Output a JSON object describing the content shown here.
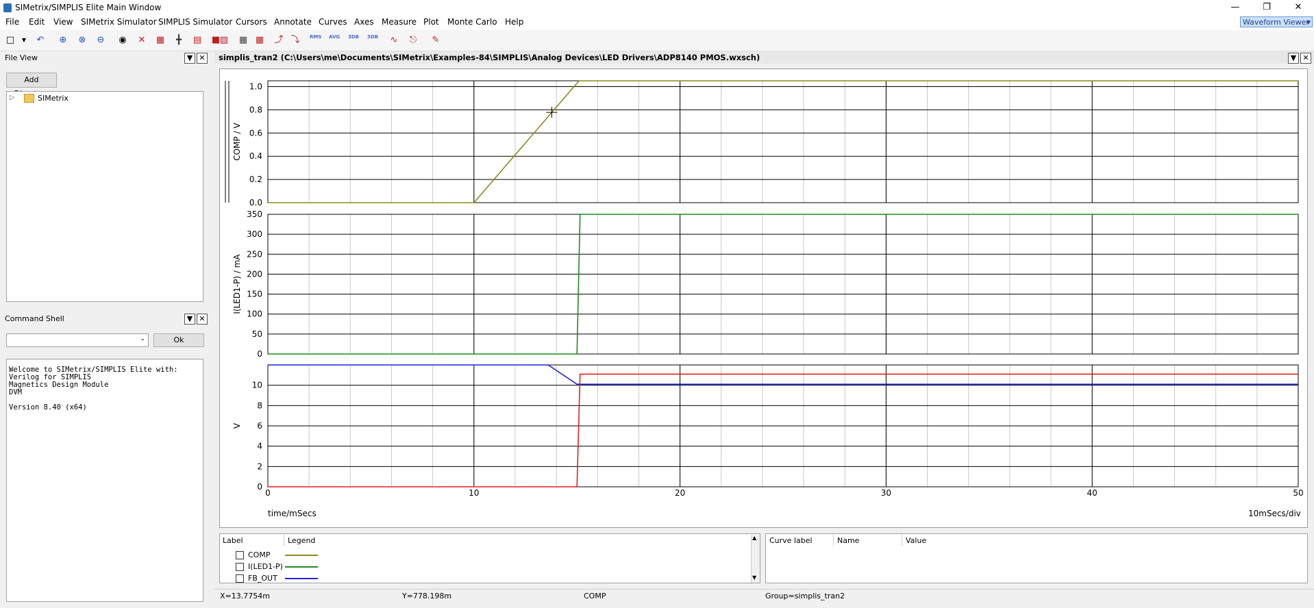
{
  "window": {
    "title": "SIMetrix/SIMPLIS Elite Main Window",
    "minimize": "—",
    "restore": "❐",
    "close": "✕"
  },
  "menu": [
    "File",
    "Edit",
    "View",
    "SIMetrix Simulator",
    "SIMPLIS Simulator",
    "Cursors",
    "Annotate",
    "Curves",
    "Axes",
    "Measure",
    "Plot",
    "Monte Carlo",
    "Help"
  ],
  "mode_select": "Waveform Viewer",
  "toolbar": {
    "rms": "RMS",
    "avg": "AVG",
    "db1": "3DB",
    "db2": "3DB"
  },
  "file_view": {
    "title": "File View",
    "add_directory": "Add Directory",
    "tree_item": "SIMetrix"
  },
  "command_shell": {
    "title": "Command Shell",
    "ok": "Ok",
    "output": "Welcome to SIMetrix/SIMPLIS Elite with:\nVerilog for SIMPLIS\nMagnetics Design Module\nDVM\n\nVersion 8.40 (x64)"
  },
  "graph_window": {
    "title": "simplis_tran2 (C:\\Users\\me\\Documents\\SIMetrix\\Examples-84\\SIMPLIS\\Analog Devices\\LED Drivers\\ADP8140 PMOS.wxsch)"
  },
  "chart_data": {
    "type": "line",
    "xlabel": "time/mSecs",
    "x_ticks": [
      0,
      10,
      20,
      30,
      40,
      50
    ],
    "xlim": [
      0,
      50
    ],
    "x_scale_note": "10mSecs/div",
    "grid": true,
    "panels": [
      {
        "ylabel": "COMP / V",
        "ylim": [
          0,
          1.05
        ],
        "y_ticks": [
          0.0,
          0.2,
          0.4,
          0.6,
          0.8,
          1.0
        ],
        "y_tick_labels": [
          "0.0",
          "0.2",
          "0.4",
          "0.6",
          "0.8",
          "1.0"
        ],
        "series": [
          {
            "name": "COMP",
            "color": "#8b8b1a",
            "x": [
              0,
              10,
              15.1,
              50
            ],
            "y": [
              0,
              0,
              1.05,
              1.05
            ]
          }
        ]
      },
      {
        "ylabel": "I(LED1-P) / mA",
        "ylim": [
          0,
          350
        ],
        "y_ticks": [
          0,
          50,
          100,
          150,
          200,
          250,
          300,
          350
        ],
        "y_tick_labels": [
          "0",
          "50",
          "100",
          "150",
          "200",
          "250",
          "300",
          "350"
        ],
        "series": [
          {
            "name": "I(LED1-P)",
            "color": "#1f8b1f",
            "x": [
              0,
              15.0,
              15.15,
              50
            ],
            "y": [
              0,
              0,
              350,
              350
            ]
          }
        ]
      },
      {
        "ylabel": "V",
        "ylim": [
          0,
          12
        ],
        "y_ticks": [
          0,
          2,
          4,
          6,
          8,
          10
        ],
        "y_tick_labels": [
          "0",
          "2",
          "4",
          "6",
          "8",
          "10"
        ],
        "series": [
          {
            "name": "FB_OUT",
            "color": "#2020e0",
            "x": [
              0,
              13.6,
              15.0,
              50
            ],
            "y": [
              12,
              12,
              10.1,
              10.1
            ]
          },
          {
            "color": "#e02020",
            "x": [
              0,
              15.0,
              15.15,
              50
            ],
            "y": [
              0,
              0,
              11.1,
              11.1
            ]
          }
        ]
      }
    ],
    "cursor": {
      "x": 13.7754,
      "panel": 0,
      "y": 0.778
    }
  },
  "legend": {
    "headers": {
      "label": "Label",
      "legend": "Legend"
    },
    "items": [
      {
        "label": "COMP",
        "color": "#8b8b1a"
      },
      {
        "label": "I(LED1-P)",
        "color": "#1f8b1f"
      },
      {
        "label": "FB_OUT",
        "color": "#2020e0"
      }
    ]
  },
  "curve_info": {
    "headers": [
      "Curve label",
      "Name",
      "Value"
    ]
  },
  "status": {
    "x": "X=13.7754m",
    "y": "Y=778.198m",
    "curve": "COMP",
    "group": "Group=simplis_tran2"
  }
}
